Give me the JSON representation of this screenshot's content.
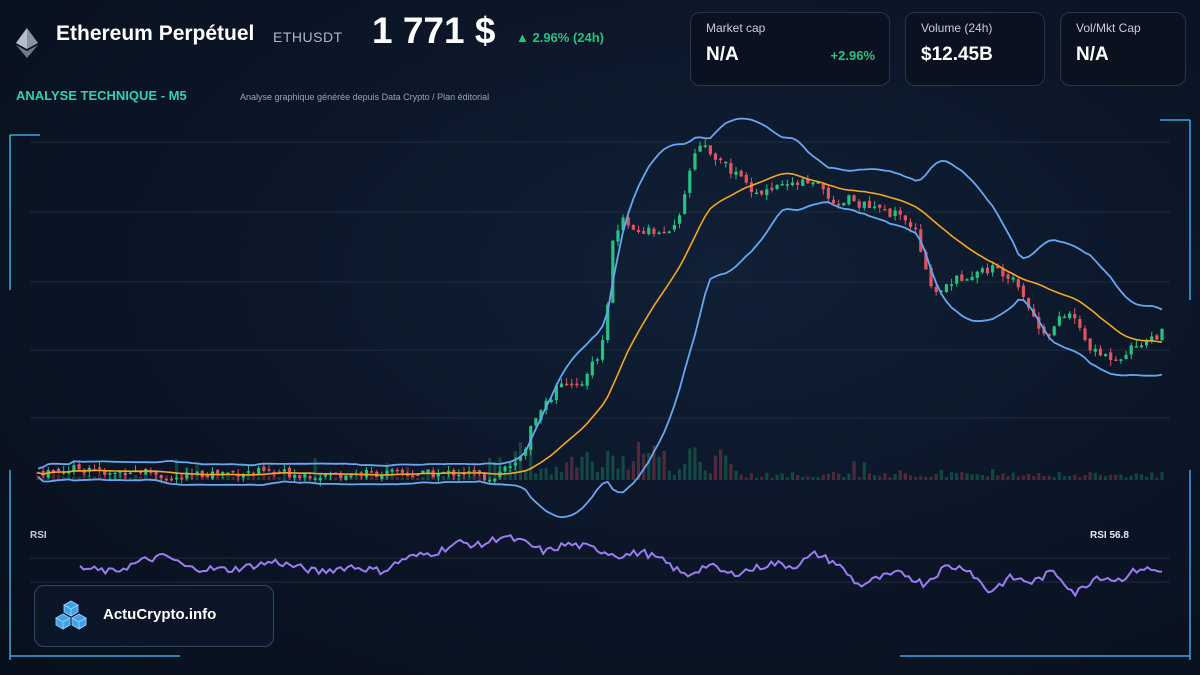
{
  "header": {
    "title": "Ethereum Perpétuel",
    "ticker": "ETHUSDT",
    "price": "1 771 $",
    "change": "▲ 2.96% (24h)"
  },
  "cards": [
    {
      "label": "Market cap",
      "value": "N/A",
      "sub": "+2.96%"
    },
    {
      "label": "Volume (24h)",
      "value": "$12.45B",
      "sub": ""
    },
    {
      "label": "Vol/Mkt Cap",
      "value": "N/A",
      "sub": ""
    }
  ],
  "section": {
    "title": "ANALYSE TECHNIQUE - M5",
    "caption": "Analyse graphique générée depuis Data Crypto / Plan éditorial"
  },
  "rsi": {
    "label": "RSI",
    "value_label": "RSI 56.8"
  },
  "brand": {
    "name": "ActuCrypto.info"
  },
  "colors": {
    "bullish": "#26c281",
    "bearish": "#e05561",
    "bollinger": "#6aa6f0",
    "moving_average": "#f5a623",
    "rsi_line": "#9b7cf2",
    "accent": "#2fd3b0",
    "frame": "#3aa8e0"
  },
  "icons": {
    "eth": "ethereum-diamond-icon",
    "brand": "stacked-cubes-icon"
  },
  "chart_data": [
    {
      "type": "line",
      "name": "price-candlestick-with-bollinger",
      "indicators": [
        "Bollinger Bands",
        "Moving Average",
        "Volume"
      ],
      "grid": true,
      "series": [
        {
          "role": "close",
          "anchors": [
            [
              0,
              5.5
            ],
            [
              0.05,
              11
            ],
            [
              0.06,
              2
            ],
            [
              0.08,
              8
            ],
            [
              0.1,
              6
            ],
            [
              0.12,
              -2
            ],
            [
              0.15,
              5
            ],
            [
              0.2,
              6
            ],
            [
              0.25,
              3
            ],
            [
              0.3,
              5
            ],
            [
              0.35,
              4
            ],
            [
              0.38,
              6
            ],
            [
              0.4,
              0
            ],
            [
              0.42,
              10
            ],
            [
              0.43,
              20
            ],
            [
              0.44,
              55
            ],
            [
              0.45,
              70
            ],
            [
              0.46,
              88
            ],
            [
              0.47,
              92
            ],
            [
              0.48,
              90
            ],
            [
              0.49,
              110
            ],
            [
              0.5,
              125
            ],
            [
              0.505,
              145
            ],
            [
              0.51,
              230
            ],
            [
              0.52,
              260
            ],
            [
              0.53,
              250
            ],
            [
              0.55,
              245
            ],
            [
              0.57,
              255
            ],
            [
              0.58,
              310
            ],
            [
              0.59,
              335
            ],
            [
              0.6,
              325
            ],
            [
              0.62,
              305
            ],
            [
              0.64,
              285
            ],
            [
              0.66,
              290
            ],
            [
              0.68,
              295
            ],
            [
              0.7,
              290
            ],
            [
              0.71,
              265
            ],
            [
              0.72,
              280
            ],
            [
              0.74,
              270
            ],
            [
              0.76,
              265
            ],
            [
              0.78,
              250
            ],
            [
              0.79,
              205
            ],
            [
              0.8,
              185
            ],
            [
              0.81,
              195
            ],
            [
              0.83,
              205
            ],
            [
              0.85,
              210
            ],
            [
              0.87,
              200
            ],
            [
              0.88,
              175
            ],
            [
              0.89,
              150
            ],
            [
              0.9,
              145
            ],
            [
              0.91,
              160
            ],
            [
              0.92,
              165
            ],
            [
              0.93,
              140
            ],
            [
              0.94,
              125
            ],
            [
              0.96,
              120
            ],
            [
              0.98,
              135
            ],
            [
              1,
              145
            ]
          ]
        }
      ]
    },
    {
      "type": "line",
      "name": "rsi",
      "series": [
        {
          "name": "RSI",
          "anchors": [
            [
              0,
              40
            ],
            [
              0.03,
              35
            ],
            [
              0.06,
              50
            ],
            [
              0.08,
              55
            ],
            [
              0.1,
              40
            ],
            [
              0.14,
              38
            ],
            [
              0.18,
              48
            ],
            [
              0.22,
              35
            ],
            [
              0.25,
              42
            ],
            [
              0.28,
              36
            ],
            [
              0.3,
              52
            ],
            [
              0.33,
              60
            ],
            [
              0.35,
              72
            ],
            [
              0.37,
              68
            ],
            [
              0.39,
              80
            ],
            [
              0.41,
              72
            ],
            [
              0.43,
              60
            ],
            [
              0.45,
              70
            ],
            [
              0.47,
              66
            ],
            [
              0.5,
              55
            ],
            [
              0.52,
              60
            ],
            [
              0.54,
              48
            ],
            [
              0.56,
              30
            ],
            [
              0.58,
              44
            ],
            [
              0.6,
              32
            ],
            [
              0.62,
              38
            ],
            [
              0.64,
              46
            ],
            [
              0.66,
              42
            ],
            [
              0.68,
              58
            ],
            [
              0.7,
              45
            ],
            [
              0.72,
              18
            ],
            [
              0.74,
              28
            ],
            [
              0.76,
              34
            ],
            [
              0.78,
              20
            ],
            [
              0.8,
              42
            ],
            [
              0.82,
              40
            ],
            [
              0.84,
              10
            ],
            [
              0.86,
              28
            ],
            [
              0.88,
              22
            ],
            [
              0.9,
              36
            ],
            [
              0.92,
              8
            ],
            [
              0.94,
              30
            ],
            [
              0.96,
              25
            ],
            [
              0.98,
              40
            ],
            [
              1,
              35
            ]
          ]
        }
      ],
      "current": 56.8
    }
  ]
}
